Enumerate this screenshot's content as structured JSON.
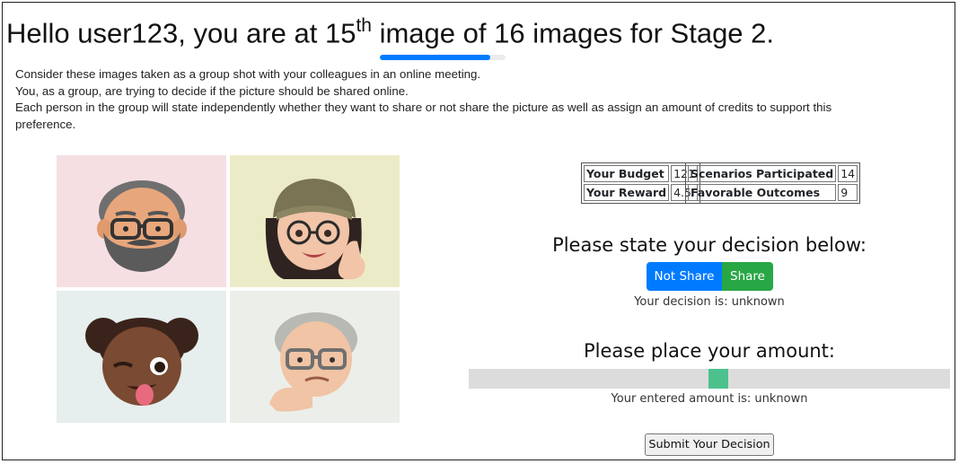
{
  "header": {
    "title_prefix": "Hello user123, you are at 15",
    "title_superscript": "th",
    "title_suffix": " image of 16 images for Stage 2."
  },
  "progress": {
    "fraction": 0.88,
    "color": "#007bff"
  },
  "intro": {
    "line1": "Consider these images taken as a group shot with your colleagues in an online meeting.",
    "line2": "You, as a group, are trying to decide if the picture should be shared online.",
    "line3": "Each person in the group will state independently whether they want to share or not share the picture as well as assign an amount of credits to support this preference."
  },
  "images": [
    {
      "name": "avatar-bearded-man",
      "background": "#f6dfe3"
    },
    {
      "name": "avatar-woman-beanie-thumbs-up",
      "background": "#ecebc7"
    },
    {
      "name": "avatar-girl-winking",
      "background": "#e6eeee"
    },
    {
      "name": "avatar-older-man-thinking",
      "background": "#eceee9"
    }
  ],
  "stats": {
    "budget_label": "Your Budget",
    "budget_value": "121",
    "reward_label": "Your Reward",
    "reward_value": "4.5",
    "scenarios_label": "Scenarios Participated",
    "scenarios_value": "14",
    "favorable_label": "Favorable Outcomes",
    "favorable_value": "9"
  },
  "decision": {
    "heading": "Please state your decision below:",
    "not_share_label": "Not Share",
    "share_label": "Share",
    "status": "Your decision is: unknown",
    "colors": {
      "not_share": "#007bff",
      "share": "#28a745"
    }
  },
  "amount": {
    "heading": "Please place your amount:",
    "slider_fraction": 0.52,
    "status": "Your entered amount is: unknown"
  },
  "submit_label": "Submit Your Decision"
}
